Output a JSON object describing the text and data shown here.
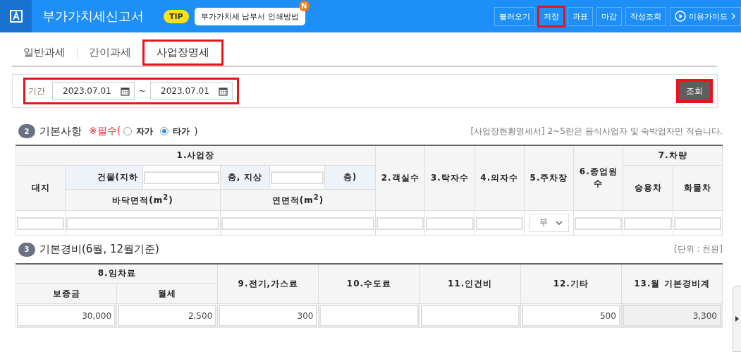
{
  "header": {
    "title": "부가가치세신고서",
    "tip": {
      "badge": "TIP",
      "text": "부가가치세 납부서 인쇄방법",
      "new_badge": "N"
    },
    "buttons": [
      {
        "label": "불러오기",
        "highlighted": false
      },
      {
        "label": "저장",
        "highlighted": true
      },
      {
        "label": "과표",
        "highlighted": false
      },
      {
        "label": "마감",
        "highlighted": false
      },
      {
        "label": "작성조회",
        "highlighted": false
      }
    ],
    "guide": {
      "label": "이용가이드"
    }
  },
  "tabs": [
    {
      "label": "일반과세",
      "selected": false,
      "highlighted": false
    },
    {
      "label": "간이과세",
      "selected": false,
      "highlighted": false
    },
    {
      "label": "사업장명세",
      "selected": true,
      "highlighted": true
    }
  ],
  "period": {
    "label": "기간",
    "from": "2023.07.01",
    "separator": "~",
    "to": "2023.07.01",
    "highlighted": true,
    "search_button": {
      "label": "조회",
      "highlighted": true
    }
  },
  "basic": {
    "number": "2",
    "title": "기본사항",
    "required": "※필수(",
    "options": [
      {
        "label": "자가",
        "selected": false
      },
      {
        "label": "타가",
        "selected": true
      }
    ],
    "closing": ")",
    "note": "[사업장현황명세서] 2~5란은 음식사업자 및 숙박업자만 적습니다.",
    "table": {
      "group": "1.사업장",
      "land": "대지",
      "building": "건물(지하",
      "floors_mid": "층, 지상",
      "floors_end": "층)",
      "floor_area": "바닥면적(m$^{2}$)",
      "total_area": "연면적(m$^{2}$)",
      "columns": [
        "2.객실수",
        "3.탁자수",
        "4.의자수",
        "5.주차장",
        "6.종업원수"
      ],
      "vehicles": "7.차량",
      "vehicle_types": [
        "승용차",
        "화물차"
      ],
      "parking": "무"
    }
  },
  "expenses": {
    "number": "3",
    "title": "기본경비(6월, 12월기준)",
    "unit": "[단위 : 천원]",
    "table": {
      "group": "8.임차료",
      "sub_columns": [
        "보증금",
        "월세"
      ],
      "columns": [
        "9.전기,가스료",
        "10.수도료",
        "11.인건비",
        "12.기타",
        "13.월 기본경비계"
      ],
      "cells": [
        {
          "value": "30,000",
          "readonly": false
        },
        {
          "value": "2,500",
          "readonly": false
        },
        {
          "value": "300",
          "readonly": false
        },
        {
          "readonly": false
        },
        {
          "readonly": false
        },
        {
          "value": "500",
          "readonly": false
        },
        {
          "value": "3,300",
          "readonly": true
        }
      ]
    }
  }
}
